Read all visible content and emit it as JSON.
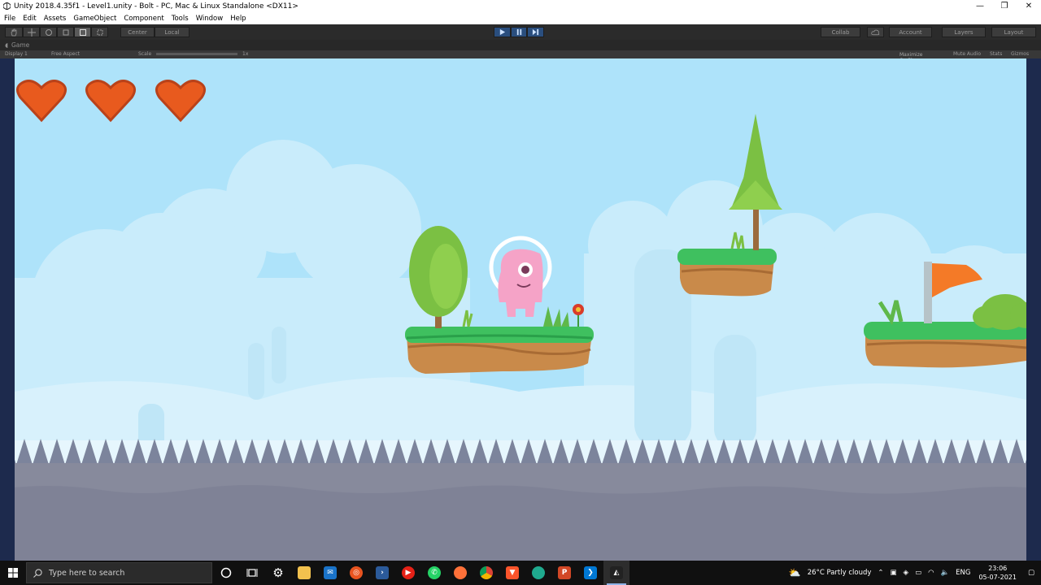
{
  "window": {
    "title": "Unity 2018.4.35f1 - Level1.unity - Bolt - PC, Mac & Linux Standalone <DX11>",
    "minimize_glyph": "—",
    "maximize_glyph": "❐",
    "close_glyph": "✕"
  },
  "menu": [
    "File",
    "Edit",
    "Assets",
    "GameObject",
    "Component",
    "Tools",
    "Window",
    "Help"
  ],
  "toolbar": {
    "pivot_label": "Center",
    "space_label": "Local",
    "collab_label": "Collab",
    "account_label": "Account",
    "layers_label": "Layers",
    "layout_label": "Layout"
  },
  "game_panel": {
    "tab_label": "Game",
    "display_label": "Display 1",
    "aspect_label": "Free Aspect",
    "scale_label": "Scale",
    "scale_value": "1x",
    "maximize_label": "Maximize On Play",
    "mute_label": "Mute Audio",
    "stats_label": "Stats",
    "gizmos_label": "Gizmos"
  },
  "game": {
    "lives": 3,
    "colors": {
      "sky": "#aee3fa",
      "heart": "#e85a1e",
      "grass": "#3fc05f",
      "dirt": "#c98a4a",
      "spikes": "#7c849c",
      "ground": "#878a9c",
      "flag": "#f47a27",
      "player": "#f5a3c7"
    }
  },
  "taskbar": {
    "search_placeholder": "Type here to search",
    "weather": "26°C  Partly cloudy",
    "lang": "ENG",
    "time": "23:06",
    "date": "05-07-2021"
  }
}
